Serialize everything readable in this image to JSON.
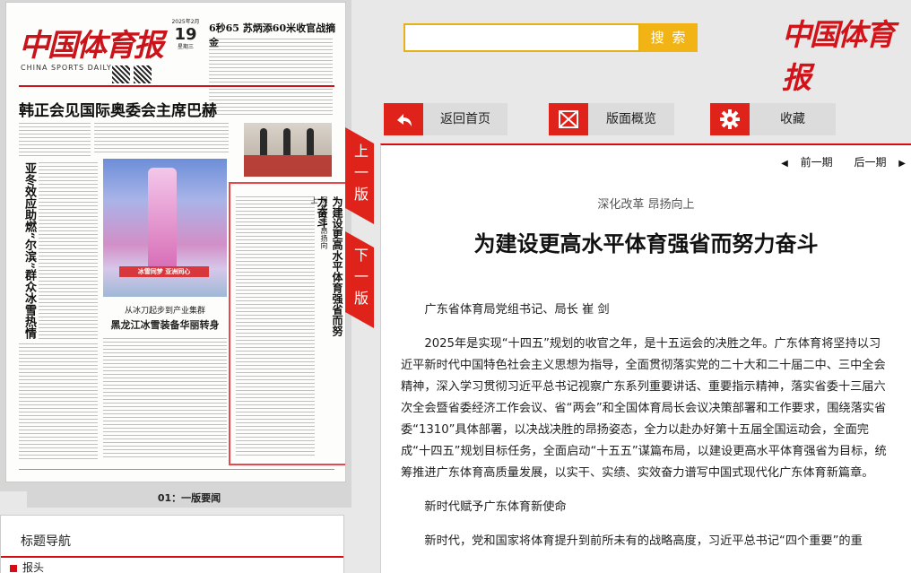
{
  "newspaper": {
    "masthead": "中国体育报",
    "masthead_en": "CHINA SPORTS DAILY",
    "date_year_month": "2025年2月",
    "date_day": "19",
    "date_weekday": "星期三",
    "teaser": "6秒65  苏炳添60米收官战摘金",
    "headline": "韩正会见国际奥委会主席巴赫",
    "vertical_head_left": "亚冬效应助燃“尔滨”群众冰雪热情",
    "vertical_head_right": "为建设更高水平体育强省而努力奋斗",
    "vertical_kicker": "深化改革  昂扬向上",
    "photo_band": "冰雪同梦 亚洲同心",
    "caption_small": "从冰刀起步到产业集群",
    "caption_main": "黑龙江冰雪装备华丽转身",
    "page_label": "01：一版要闻"
  },
  "side_tabs": {
    "prev": "上一版",
    "next": "下一版"
  },
  "nav": {
    "title": "标题导航",
    "first_item": "报头"
  },
  "search": {
    "placeholder": "",
    "button": "搜 索"
  },
  "brand": "中国体育报",
  "actions": [
    {
      "label": "返回首页",
      "icon": "reply-arrow-icon"
    },
    {
      "label": "版面概览",
      "icon": "envelope-icon"
    },
    {
      "label": "收藏",
      "icon": "gear-icon"
    }
  ],
  "pager": {
    "prev": "前一期",
    "next": "后一期"
  },
  "article": {
    "subtitle": "深化改革  昂扬向上",
    "headline": "为建设更高水平体育强省而努力奋斗",
    "byline": "广东省体育局党组书记、局长  崔  剑",
    "para1": "2025年是实现“十四五”规划的收官之年，是十五运会的决胜之年。广东体育将坚持以习近平新时代中国特色社会主义思想为指导，全面贯彻落实党的二十大和二十届二中、三中全会精神，深入学习贯彻习近平总书记视察广东系列重要讲话、重要指示精神，落实省委十三届六次全会暨省委经济工作会议、省“两会”和全国体育局长会议决策部署和工作要求，围绕落实省委“1310”具体部署，以决战决胜的昂扬姿态，全力以赴办好第十五届全国运动会，全面完成“十四五”规划目标任务，全面启动“十五五”谋篇布局，以建设更高水平体育强省为目标，统筹推进广东体育高质量发展，以实干、实绩、实效奋力谱写中国式现代化广东体育新篇章。",
    "section": "新时代赋予广东体育新使命",
    "para2": "新时代，党和国家将体育提升到前所未有的战略高度，习近平总书记“四个重要”的重"
  }
}
